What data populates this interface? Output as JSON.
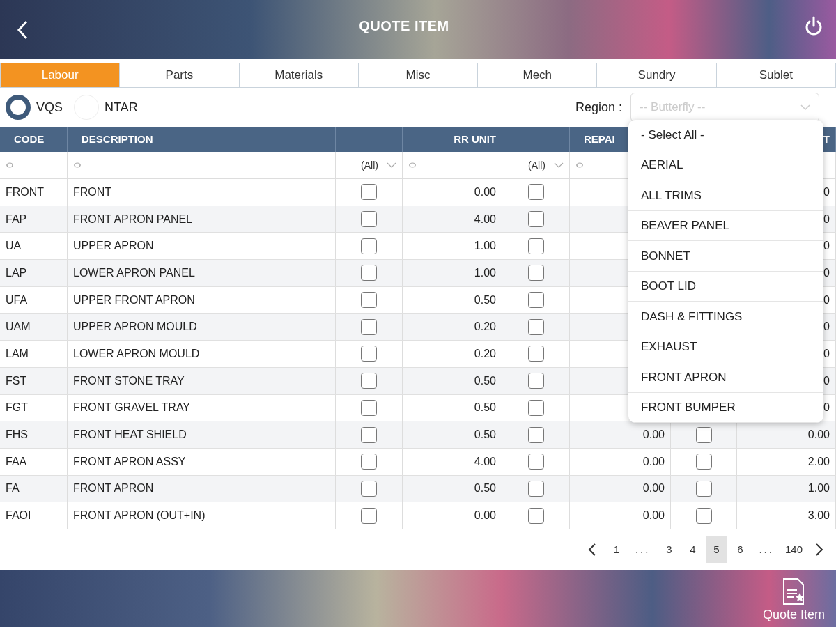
{
  "header": {
    "title": "QUOTE ITEM"
  },
  "tabs": [
    {
      "label": "Labour",
      "selected": true
    },
    {
      "label": "Parts",
      "selected": false
    },
    {
      "label": "Materials",
      "selected": false
    },
    {
      "label": "Misc",
      "selected": false
    },
    {
      "label": "Mech",
      "selected": false
    },
    {
      "label": "Sundry",
      "selected": false
    },
    {
      "label": "Sublet",
      "selected": false
    }
  ],
  "radios": [
    {
      "label": "VQS",
      "selected": true
    },
    {
      "label": "NTAR",
      "selected": false
    }
  ],
  "region": {
    "label": "Region :",
    "placeholder": "-- Butterfly --",
    "expanded": true,
    "options": [
      "- Select All -",
      "AERIAL",
      "ALL TRIMS",
      "BEAVER PANEL",
      "BONNET",
      "BOOT LID",
      "DASH & FITTINGS",
      "EXHAUST",
      "FRONT APRON",
      "FRONT BUMPER"
    ]
  },
  "columns": [
    {
      "kind": "text",
      "label": "CODE",
      "filter": {
        "kind": "search"
      }
    },
    {
      "kind": "text",
      "label": "DESCRIPTION",
      "filter": {
        "kind": "search"
      }
    },
    {
      "kind": "check",
      "filter": {
        "kind": "select",
        "value": "(All)"
      }
    },
    {
      "kind": "number",
      "label": "RR UNIT",
      "filter": {
        "kind": "search"
      }
    },
    {
      "kind": "check",
      "filter": {
        "kind": "select",
        "value": "(All)"
      }
    },
    {
      "kind": "number",
      "label": "REPAI",
      "filter": {
        "kind": "search"
      }
    },
    {
      "kind": "check"
    },
    {
      "kind": "number",
      "label": "T"
    }
  ],
  "rows": [
    {
      "cells": [
        "FRONT",
        "FRONT",
        false,
        "0.00",
        false,
        null,
        null,
        "0"
      ]
    },
    {
      "cells": [
        "FAP",
        "FRONT APRON PANEL",
        false,
        "4.00",
        false,
        null,
        null,
        "0"
      ]
    },
    {
      "cells": [
        "UA",
        "UPPER APRON",
        false,
        "1.00",
        false,
        null,
        null,
        "0"
      ]
    },
    {
      "cells": [
        "LAP",
        "LOWER APRON PANEL",
        false,
        "1.00",
        false,
        null,
        null,
        "0"
      ]
    },
    {
      "cells": [
        "UFA",
        "UPPER FRONT APRON",
        false,
        "0.50",
        false,
        null,
        null,
        "0"
      ]
    },
    {
      "cells": [
        "UAM",
        "UPPER APRON MOULD",
        false,
        "0.20",
        false,
        null,
        null,
        "0"
      ]
    },
    {
      "cells": [
        "LAM",
        "LOWER APRON MOULD",
        false,
        "0.20",
        false,
        null,
        null,
        "0"
      ]
    },
    {
      "cells": [
        "FST",
        "FRONT STONE TRAY",
        false,
        "0.50",
        false,
        null,
        null,
        "0"
      ]
    },
    {
      "cells": [
        "FGT",
        "FRONT GRAVEL TRAY",
        false,
        "0.50",
        false,
        null,
        null,
        "0"
      ]
    },
    {
      "cells": [
        "FHS",
        "FRONT HEAT SHIELD",
        false,
        "0.50",
        false,
        "0.00",
        false,
        "0.00"
      ]
    },
    {
      "cells": [
        "FAA",
        "FRONT APRON ASSY",
        false,
        "4.00",
        false,
        "0.00",
        false,
        "2.00"
      ]
    },
    {
      "cells": [
        "FA",
        "FRONT APRON",
        false,
        "0.50",
        false,
        "0.00",
        false,
        "1.00"
      ]
    },
    {
      "cells": [
        "FAOI",
        "FRONT APRON (OUT+IN)",
        false,
        "0.00",
        false,
        "0.00",
        false,
        "3.00"
      ]
    }
  ],
  "pagination": [
    {
      "kind": "prev"
    },
    {
      "kind": "page",
      "label": "1",
      "selected": false
    },
    {
      "kind": "gap",
      "label": "..."
    },
    {
      "kind": "page",
      "label": "3",
      "selected": false
    },
    {
      "kind": "page",
      "label": "4",
      "selected": false
    },
    {
      "kind": "page",
      "label": "5",
      "selected": true
    },
    {
      "kind": "page",
      "label": "6",
      "selected": false
    },
    {
      "kind": "gap",
      "label": "..."
    },
    {
      "kind": "page",
      "label": "140",
      "selected": false
    },
    {
      "kind": "next"
    }
  ],
  "footer": {
    "action": "Quote Item"
  }
}
